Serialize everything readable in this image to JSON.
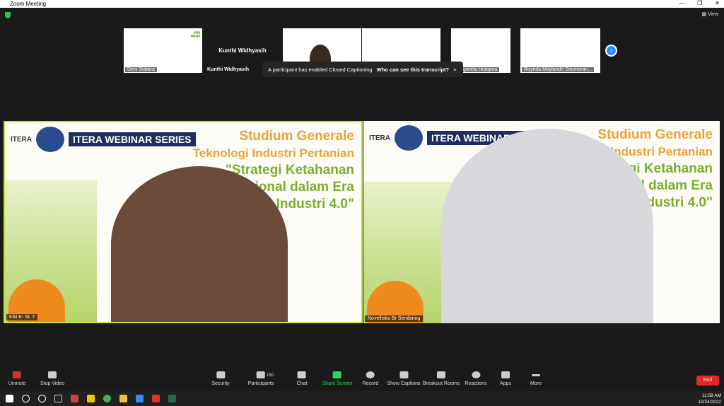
{
  "window": {
    "title": "Zoom Meeting",
    "view_label": "View"
  },
  "thumbnails": [
    {
      "name": "Deni Subara"
    },
    {
      "name": "Kunthi Widhyasih",
      "display": "Kunthi Widhyasih"
    },
    {
      "name": ""
    },
    {
      "name": ""
    },
    {
      "name": "Margareta Hutapea"
    },
    {
      "name": "Roynda Maylandri Situmoran..."
    }
  ],
  "toast": {
    "message": "A participant has enabled Closed Captioning",
    "link": "Who can see this transcript?",
    "close": "×"
  },
  "slide": {
    "line1": "Studium Generale",
    "line2": "Teknologi Industri Pertanian",
    "line3": "\"Strategi Ketahanan",
    "line4": "Gula Nasional dalam Era",
    "line5": "Globalisasi dan Industri 4.0\"",
    "itera": "ITERA",
    "webinar": "ITERA WEBINAR SERIES"
  },
  "tiles": [
    {
      "name": "Kiki K- SL 7"
    },
    {
      "name": "Novelliska Br Sembiring"
    }
  ],
  "toolbar": {
    "unmute": "Unmute",
    "stop_video": "Stop Video",
    "security": "Security",
    "participants": "Participants",
    "participant_count": "150",
    "chat": "Chat",
    "share": "Share Screen",
    "record": "Record",
    "captions": "Show Captions",
    "breakout": "Breakout Rooms",
    "reactions": "Reactions",
    "apps": "Apps",
    "more": "More",
    "end": "End"
  },
  "clock": {
    "time": "11:58 AM",
    "date": "10/24/2022"
  }
}
